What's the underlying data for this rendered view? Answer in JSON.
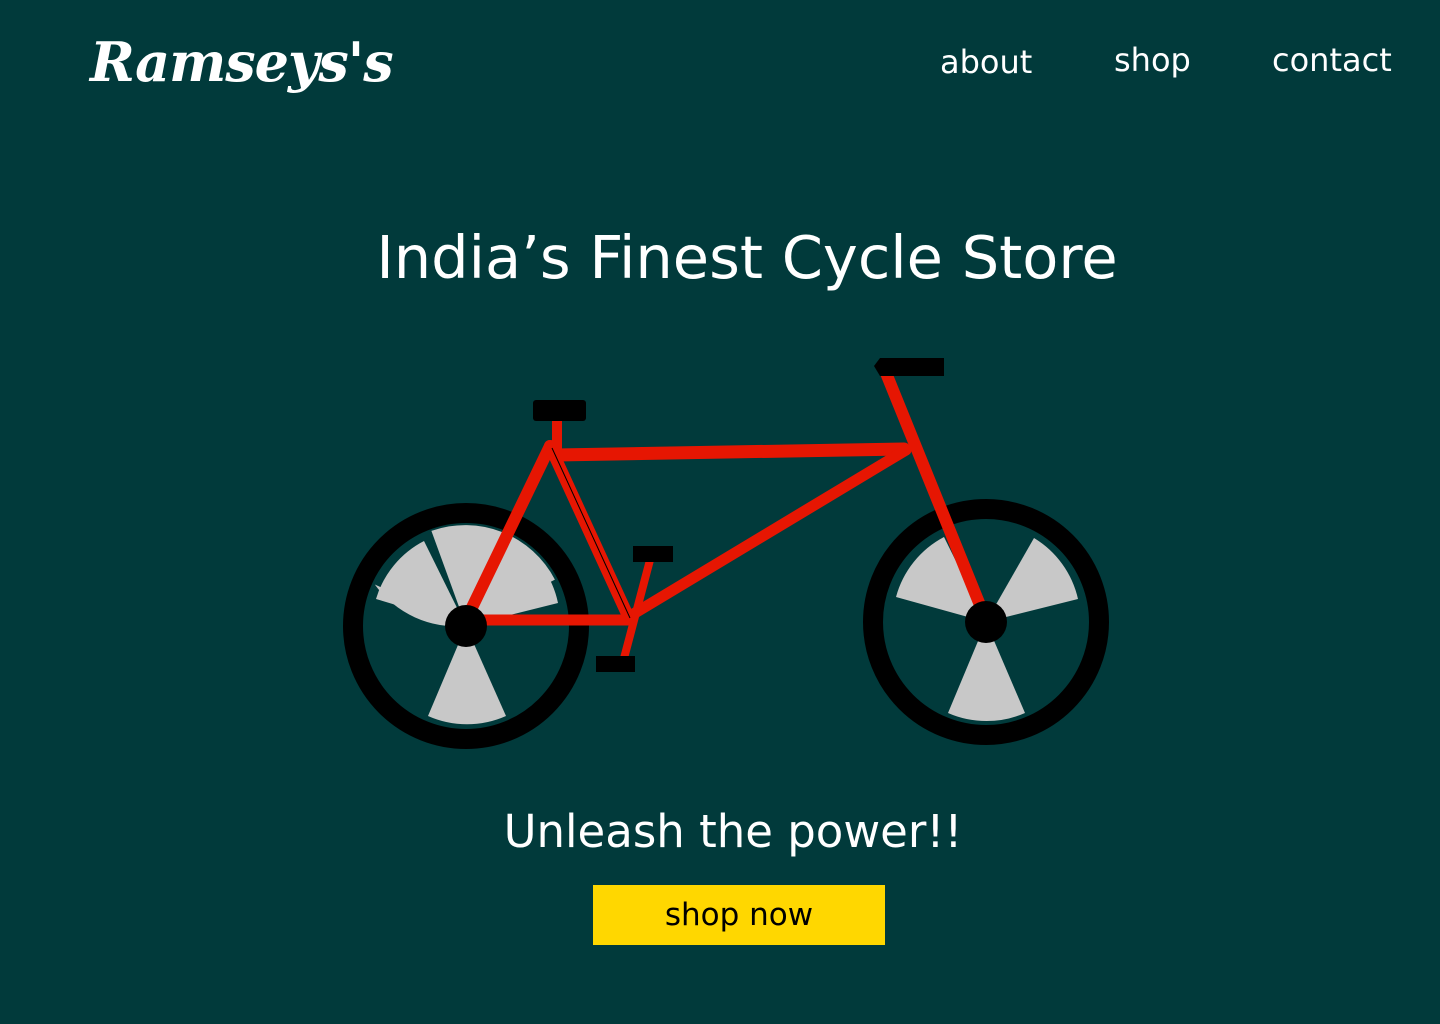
{
  "header": {
    "logo": "Ramseys's",
    "nav": {
      "about": "about",
      "shop": "shop",
      "contact": "contact"
    }
  },
  "hero": {
    "title": "India’s Finest Cycle Store",
    "tagline": "Unleash the power!!",
    "cta_label": "shop now"
  },
  "colors": {
    "background": "#013a3b",
    "text": "#ffffff",
    "bike_frame": "#e61602",
    "tire": "#000000",
    "wheel_fill": "#c8c8c8",
    "cta_background": "#ffd700",
    "cta_text": "#000000"
  },
  "icons": {
    "hero_illustration": "bicycle-illustration"
  }
}
